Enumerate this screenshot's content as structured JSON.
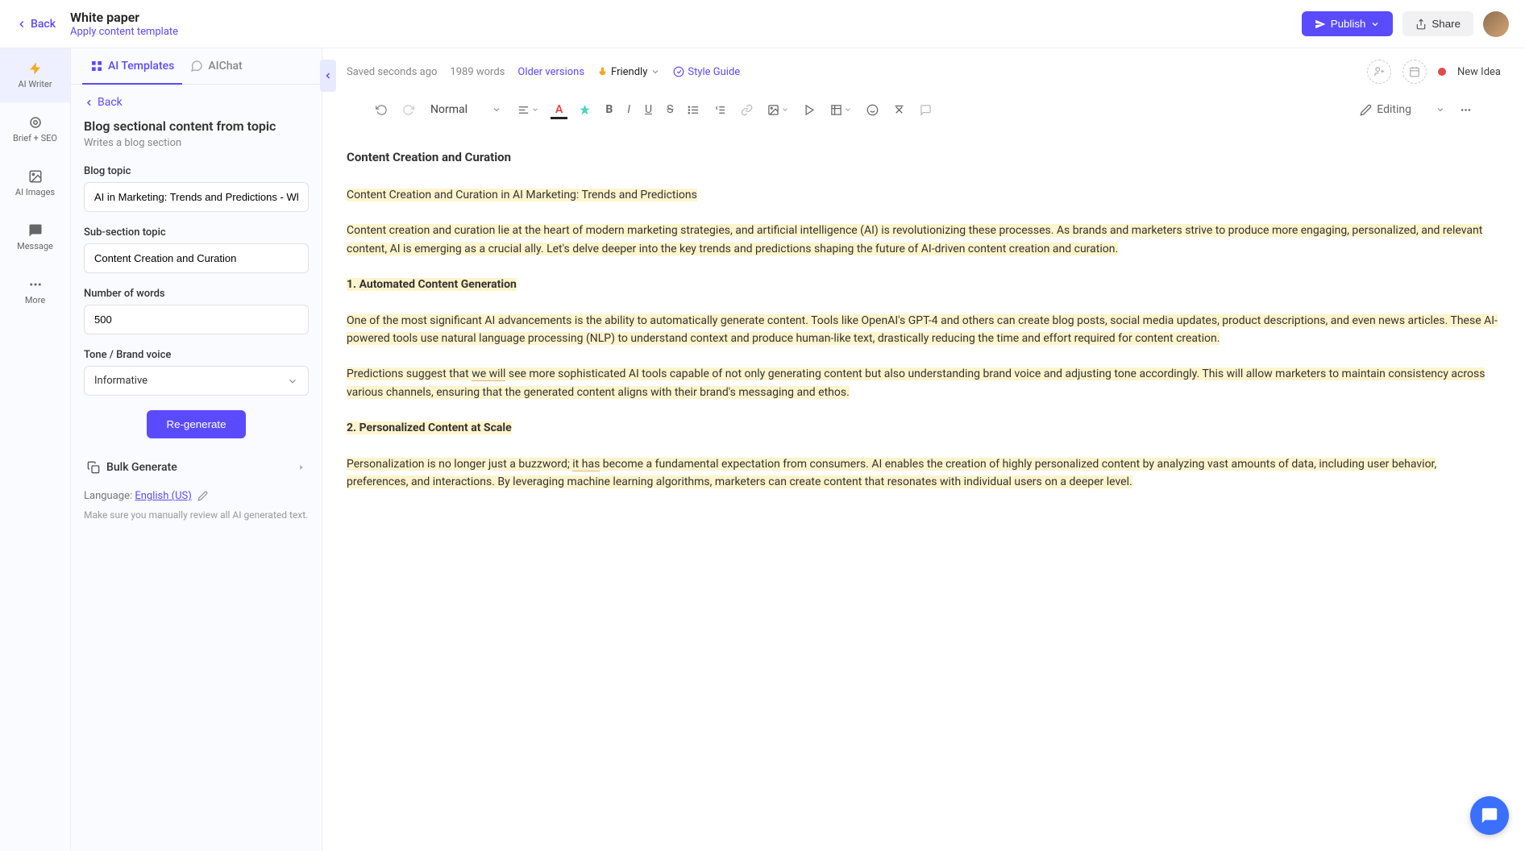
{
  "topbar": {
    "back": "Back",
    "title": "White paper",
    "apply_template": "Apply content template",
    "publish": "Publish",
    "share": "Share"
  },
  "rail": {
    "ai_writer": "AI Writer",
    "brief_seo": "Brief + SEO",
    "ai_images": "AI Images",
    "message": "Message",
    "more": "More"
  },
  "sidebar": {
    "tabs": {
      "templates": "AI Templates",
      "chat": "AIChat"
    },
    "back": "Back",
    "template_title": "Blog sectional content from topic",
    "template_desc": "Writes a blog section",
    "fields": {
      "blog_topic_label": "Blog topic",
      "blog_topic_value": "AI in Marketing: Trends and Predictions - Wh",
      "sub_section_label": "Sub-section topic",
      "sub_section_value": "Content Creation and Curation",
      "words_label": "Number of words",
      "words_value": "500",
      "tone_label": "Tone / Brand voice",
      "tone_value": "Informative"
    },
    "regenerate": "Re-generate",
    "bulk_generate": "Bulk Generate",
    "language_prefix": "Language: ",
    "language_value": "English (US)",
    "review_note": "Make sure you manually review all AI generated text."
  },
  "editor": {
    "meta": {
      "saved": "Saved seconds ago",
      "word_count": "1989 words",
      "older": "Older versions",
      "friendly": "Friendly",
      "style_guide": "Style Guide",
      "status": "New Idea"
    },
    "toolbar": {
      "format": "Normal",
      "editing": "Editing"
    },
    "content": {
      "heading": "Content Creation and Curation",
      "p1": "Content Creation and Curation in AI Marketing: Trends and Predictions",
      "p2": "Content creation and curation lie at the heart of modern marketing strategies, and artificial intelligence (AI) is revolutionizing these processes. As brands and marketers strive to produce more engaging, personalized, and relevant content, AI is emerging as a crucial ally. Let's delve deeper into the key trends and predictions shaping the future of AI-driven content creation and curation.",
      "h1": "1. Automated Content Generation",
      "p3": "One of the most significant AI advancements is the ability to automatically generate content. Tools like OpenAI's GPT-4 and others can create blog posts, social media updates, product descriptions, and even news articles. These AI-powered tools use natural language processing (NLP) to understand context and produce human-like text, drastically reducing the time and effort required for content creation.",
      "p4_pre": "Predictions suggest that ",
      "p4_u": "we will",
      "p4_post": " see more sophisticated AI tools capable of not only generating content but also understanding brand voice and adjusting tone accordingly. This will allow marketers to maintain consistency across various channels, ensuring that the generated content aligns with their brand's messaging and ethos.",
      "h2": "2. Personalized Content at Scale",
      "p5_pre": "Personalization is no longer just a buzzword; ",
      "p5_u": "it has",
      "p5_post": " become a fundamental expectation from consumers. AI enables the creation of highly personalized content by analyzing vast amounts of data, including user behavior, preferences, and interactions. By leveraging machine learning algorithms, marketers can create content that resonates with individual users on a deeper level."
    }
  }
}
